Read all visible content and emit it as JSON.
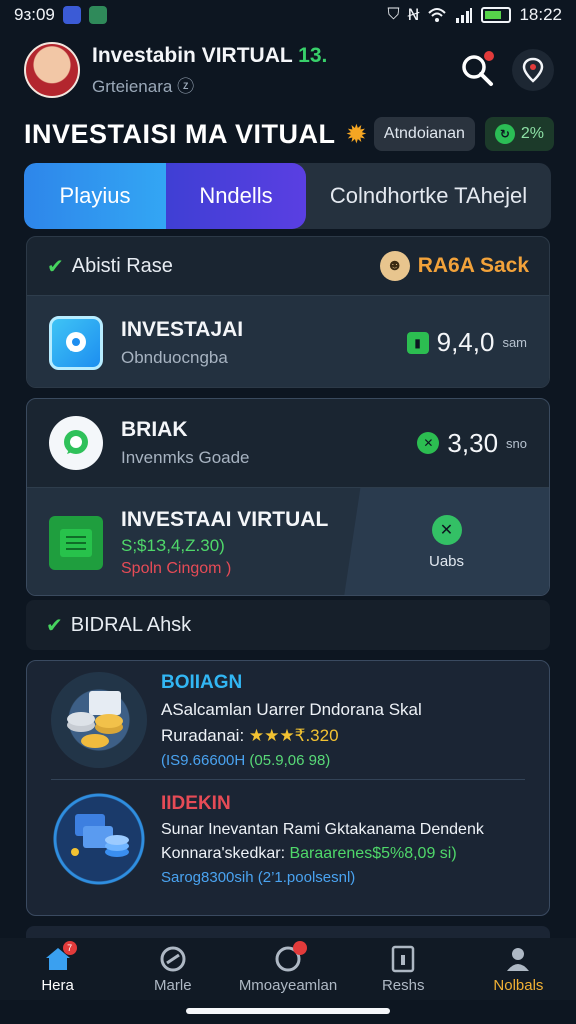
{
  "status_bar": {
    "time": "9з:09",
    "time_right": "18:22"
  },
  "header": {
    "user_name_main": "Investabin VIRTUAL",
    "user_name_accent": "13.",
    "user_subtitle": "Grteienara",
    "notification_badge": true
  },
  "title_row": {
    "title": "INVESTAISI MA VITUAL",
    "pill_label": "Atndoianan",
    "percent_label": "2%"
  },
  "tabs": [
    {
      "label": "Playius"
    },
    {
      "label": "Nndells"
    },
    {
      "label": "Colndhortke TAhejel"
    }
  ],
  "card1": {
    "header_label": "Abisti Rase",
    "header_right_label": "RA6A Sack",
    "row1": {
      "title": "INVESTAJAI",
      "subtitle": "Obnduocngba",
      "value": "9,4,0",
      "unit": "sam"
    },
    "row2": {
      "title": "BRIAK",
      "subtitle": "Invenmks Goade",
      "value": "3,30",
      "unit": "sno"
    },
    "row3": {
      "title": "INVESTAAI VIRTUAL",
      "value_line": "S;$1З,4,Z.30)",
      "error_line": "Spoln Cingom )",
      "side_label": "Uabs"
    }
  },
  "section_label": "BIDRAL Ahsk",
  "offers": [
    {
      "title": "BOIIAGN",
      "line1": "ASalcamlan Uarrer Dndorana Skal",
      "line2_prefix": "Ruradanai:",
      "line2_suffix": "₹.320",
      "stars": "★★★",
      "meta_blue": "(IS9.66600H",
      "meta_green": "(05.9,06 98)"
    },
    {
      "title": "IIDEKIN",
      "line1": "Sunar Inevantan Rami Gktakanama Dendenk",
      "line2_prefix": "Konnara'skedkar:",
      "line2_suffix": "Baraarenes$5%8,09 si)",
      "meta_blue": "Sarog8300sih",
      "meta_green": "(2’1.poolsesnl)"
    }
  ],
  "nav": [
    {
      "label": "Hera",
      "badge": "7"
    },
    {
      "label": "Marle"
    },
    {
      "label": "Mmoayeamlan",
      "badge": ""
    },
    {
      "label": "Reshs"
    },
    {
      "label": "Nolbals"
    }
  ],
  "colors": {
    "background": "#0d1621",
    "accent_blue": "#2e86ea",
    "accent_purple": "#4b3fdb",
    "green": "#46d35e",
    "gold": "#f2a23a",
    "red": "#e64b56"
  }
}
